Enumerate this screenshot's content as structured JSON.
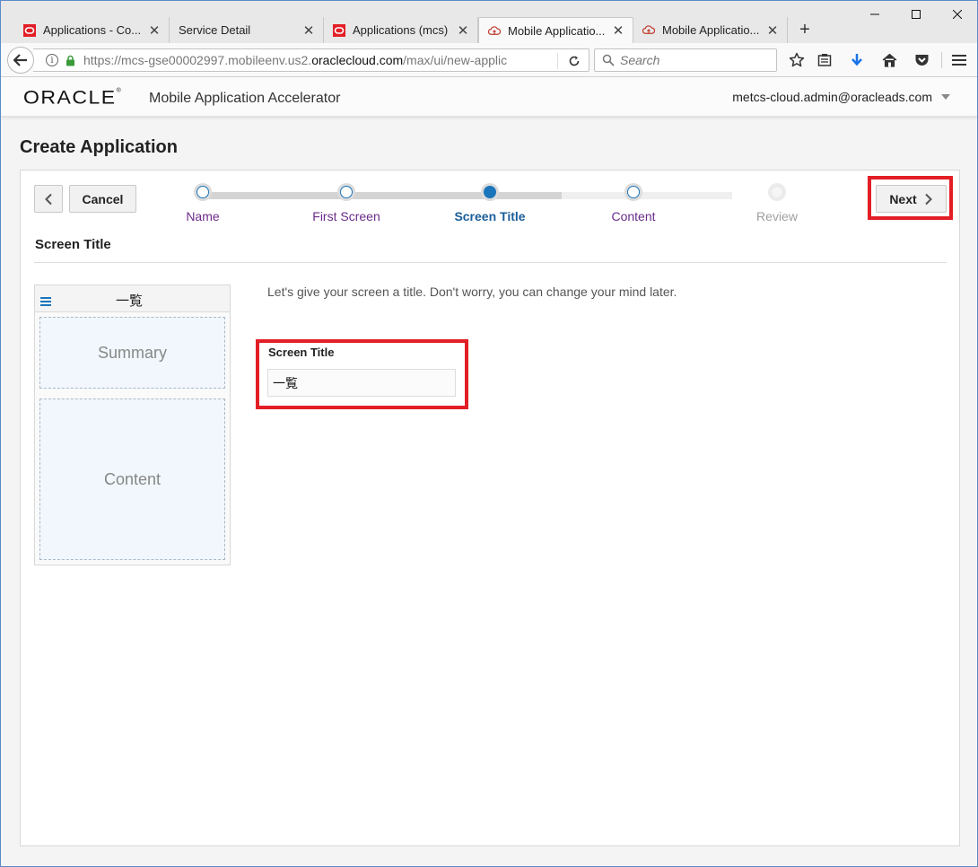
{
  "browser": {
    "tabs": [
      {
        "title": "Applications - Co...",
        "favicon": "oracle-cloud-icon"
      },
      {
        "title": "Service Detail",
        "favicon": "none"
      },
      {
        "title": "Applications (mcs)",
        "favicon": "oracle-cloud-icon"
      },
      {
        "title": "Mobile Applicatio...",
        "favicon": "cloud-icon",
        "active": true
      },
      {
        "title": "Mobile Applicatio...",
        "favicon": "cloud-icon"
      }
    ],
    "url_prefix": "https://mcs-gse00002997.mobileenv.us2.",
    "url_domain": "oraclecloud.com",
    "url_suffix": "/max/ui/new-applic",
    "search_placeholder": "Search"
  },
  "header": {
    "logo_text": "ORACLE",
    "app_name": "Mobile Application Accelerator",
    "user": "metcs-cloud.admin@oracleads.com"
  },
  "page": {
    "title": "Create Application"
  },
  "wizard": {
    "cancel_label": "Cancel",
    "next_label": "Next",
    "steps": [
      {
        "label": "Name",
        "state": "done"
      },
      {
        "label": "First Screen",
        "state": "done"
      },
      {
        "label": "Screen Title",
        "state": "current"
      },
      {
        "label": "Content",
        "state": "todo"
      },
      {
        "label": "Review",
        "state": "disabled"
      }
    ],
    "section_title": "Screen Title"
  },
  "preview": {
    "screen_title": "一覧",
    "summary_label": "Summary",
    "content_label": "Content"
  },
  "form": {
    "intro": "Let's give your screen a title. Don't worry, you can change your mind later.",
    "screen_title_label": "Screen Title",
    "screen_title_value": "一覧"
  },
  "colors": {
    "accent": "#1b75bb",
    "step_done_label": "#6b2c8a",
    "highlight": "#e31e26"
  }
}
